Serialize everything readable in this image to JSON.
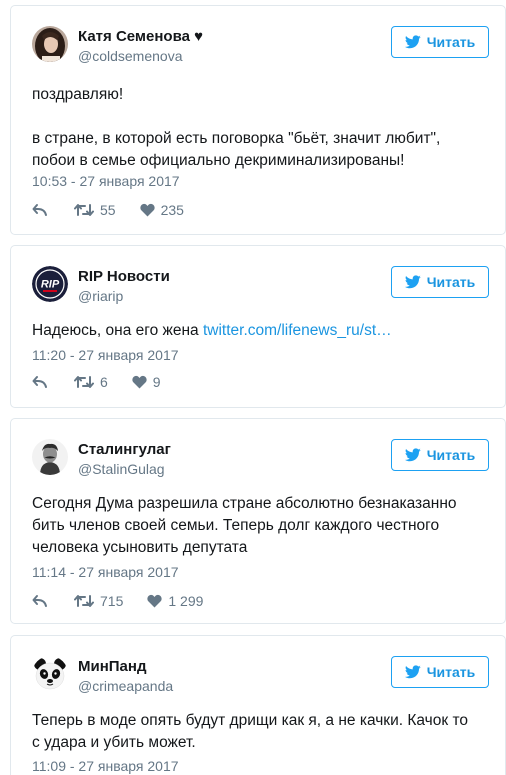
{
  "follow_label": "Читать",
  "colors": {
    "accent": "#1da1f2",
    "link": "#1b95e0",
    "muted": "#657786",
    "text": "#14171a",
    "border": "#e1e8ed"
  },
  "tweets": [
    {
      "name": "Катя Семенова ♥",
      "handle": "@coldsemenova",
      "avatar": "user-photo",
      "text_lines": [
        "поздравляю!",
        "",
        "в стране, в которой есть поговорка \"бьёт, значит любит\",",
        "побои в семье официально декриминализированы!"
      ],
      "link": "",
      "time": "10:53 - 27 января 2017",
      "retweets": "55",
      "likes": "235"
    },
    {
      "name": "RIP Новости",
      "handle": "@riarip",
      "avatar": "rip-logo",
      "avatar_text": "RIP",
      "text_lines": [
        "Надеюсь, она его жена "
      ],
      "link": "twitter.com/lifenews_ru/st…",
      "time": "11:20 - 27 января 2017",
      "retweets": "6",
      "likes": "9"
    },
    {
      "name": "Сталингулаг",
      "handle": "@StalinGulag",
      "avatar": "stalin-portrait",
      "text_lines": [
        "Сегодня Дума разрешила стране абсолютно безнаказанно",
        "бить членов своей семьи. Теперь долг каждого честного",
        "человека усыновить депутата"
      ],
      "link": "",
      "time": "11:14 - 27 января 2017",
      "retweets": "715",
      "likes": "1 299"
    },
    {
      "name": "МинПанд",
      "handle": "@crimeapanda",
      "avatar": "panda",
      "text_lines": [
        "Теперь в моде опять будут дрищи как я, а не качки. Качок то",
        "с удара и убить может."
      ],
      "link": "",
      "time": "11:09 - 27 января 2017",
      "retweets": "",
      "likes": ""
    }
  ]
}
